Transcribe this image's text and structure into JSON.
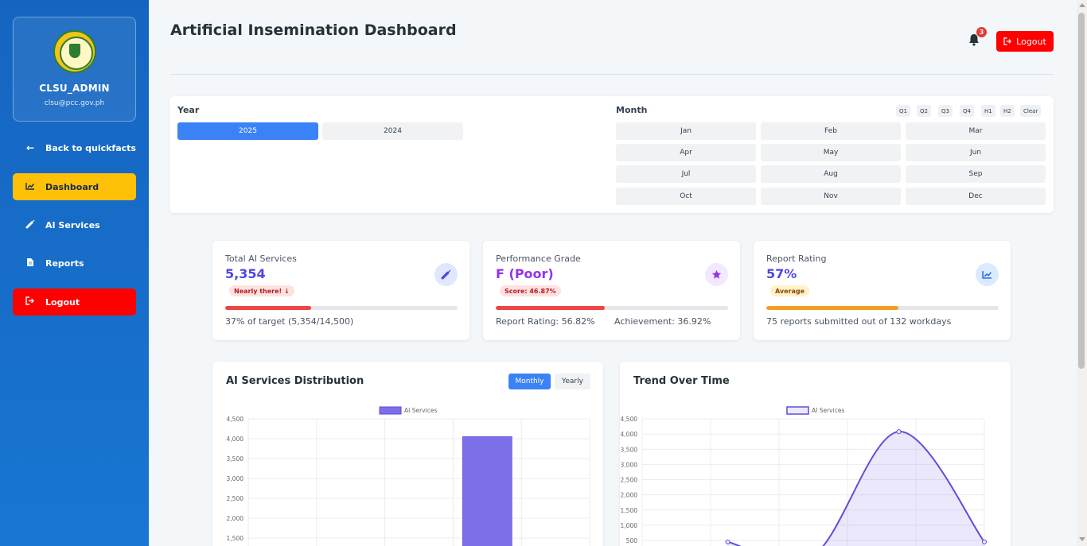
{
  "sidebar": {
    "username": "CLSU_ADMIN",
    "email": "clsu@pcc.gov.ph",
    "items": [
      {
        "label": "Back to quickfacts",
        "icon": "arrow-left-icon"
      },
      {
        "label": "Dashboard",
        "icon": "chart-line-icon"
      },
      {
        "label": "AI Services",
        "icon": "syringe-icon"
      },
      {
        "label": "Reports",
        "icon": "file-icon"
      },
      {
        "label": "Logout",
        "icon": "logout-icon"
      }
    ]
  },
  "header": {
    "title": "Artificial Insemination Dashboard",
    "notification_count": "3",
    "logout_label": "Logout"
  },
  "filters": {
    "year_label": "Year",
    "years": [
      "2025",
      "2024"
    ],
    "selected_year": "2025",
    "month_label": "Month",
    "quick": [
      "Q1",
      "Q2",
      "Q3",
      "Q4",
      "H1",
      "H2",
      "Clear"
    ],
    "months": [
      "Jan",
      "Feb",
      "Mar",
      "Apr",
      "May",
      "Jun",
      "Jul",
      "Aug",
      "Sep",
      "Oct",
      "Nov",
      "Dec"
    ]
  },
  "cards": [
    {
      "title": "Total AI Services",
      "value": "5,354",
      "badge": "Nearly there! ↓",
      "progress": 37,
      "footer": "37% of target (5,354/14,500)",
      "value_color": "#4f46e5",
      "bar_color": "#ef4444",
      "icon": "syringe-icon"
    },
    {
      "title": "Performance Grade",
      "value": "F (Poor)",
      "badge": "Score: 46.87%",
      "progress": 46.87,
      "footer_left": "Report Rating: 56.82%",
      "footer_right": "Achievement: 36.92%",
      "value_color": "#9333ea",
      "bar_color": "#ef4444",
      "icon": "star-icon"
    },
    {
      "title": "Report Rating",
      "value": "57%",
      "badge": "Average",
      "progress": 57,
      "footer": "75 reports submitted out of 132 workdays",
      "value_color": "#4f46e5",
      "bar_color": "#f0a020",
      "icon": "chart-line-icon"
    }
  ],
  "panels": {
    "distribution": {
      "title": "AI Services Distribution",
      "toggle": [
        "Monthly",
        "Yearly"
      ],
      "active": "Monthly"
    },
    "trend": {
      "title": "Trend Over Time"
    }
  },
  "chart_data": [
    {
      "type": "bar",
      "title": "AI Services Distribution",
      "series": [
        {
          "name": "AI Services",
          "color": "#7c6fe8",
          "values": [
            null,
            null,
            null,
            4050,
            null
          ]
        }
      ],
      "categories": [
        "",
        "",
        "",
        "",
        ""
      ],
      "ylim": [
        1500,
        4500
      ],
      "yticks": [
        "1,500",
        "2,000",
        "2,500",
        "3,000",
        "3,500",
        "4,000",
        "4,500"
      ],
      "grid": true,
      "legend": "top"
    },
    {
      "type": "area",
      "title": "Trend Over Time",
      "series": [
        {
          "name": "AI Services",
          "color": "#5b4fd6",
          "values": [
            null,
            450,
            0,
            4080,
            450
          ]
        }
      ],
      "x": [
        0,
        1,
        2,
        3,
        4
      ],
      "ylim": [
        500,
        4500
      ],
      "yticks": [
        "500",
        "1,000",
        "1,500",
        "2,000",
        "2,500",
        "3,000",
        "3,500",
        "4,000",
        "4,500"
      ],
      "grid": true,
      "legend": "top"
    }
  ]
}
